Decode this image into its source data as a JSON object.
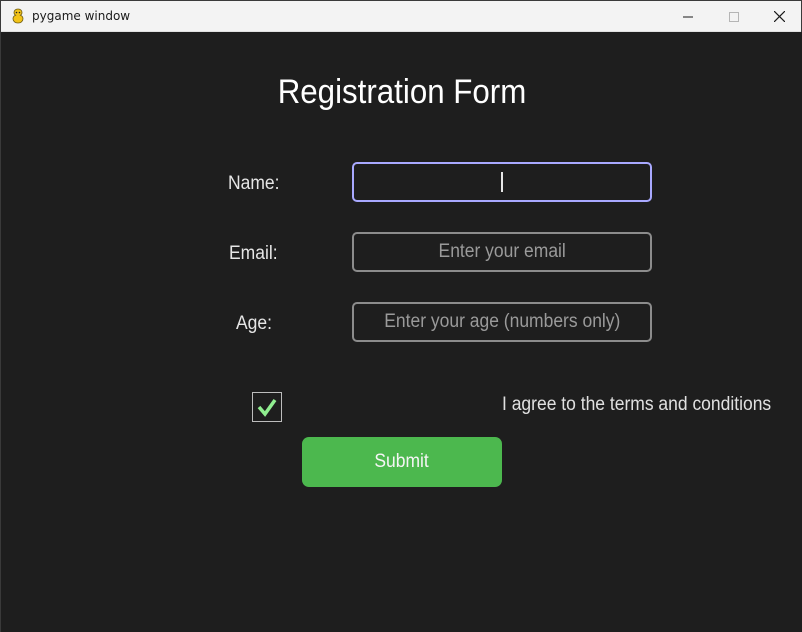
{
  "window": {
    "title": "pygame window",
    "app_icon": "pygame-snake-icon",
    "controls": {
      "minimize_icon": "minimize-icon",
      "maximize_icon": "maximize-icon",
      "close_icon": "close-icon"
    }
  },
  "form": {
    "title": "Registration Form",
    "fields": [
      {
        "label": "Name:",
        "value": "",
        "placeholder": "",
        "focused": true
      },
      {
        "label": "Email:",
        "value": "",
        "placeholder": "Enter your email",
        "focused": false
      },
      {
        "label": "Age:",
        "value": "",
        "placeholder": "Enter your age (numbers only)",
        "focused": false
      }
    ],
    "terms": {
      "checked": true,
      "label": "I agree to the terms and conditions"
    },
    "submit_label": "Submit"
  },
  "colors": {
    "background": "#1e1e1e",
    "field_border": "#8c8c8c",
    "field_border_focused": "#a9a9ff",
    "submit_bg": "#4cb84e",
    "checkmark": "#90ee90"
  }
}
